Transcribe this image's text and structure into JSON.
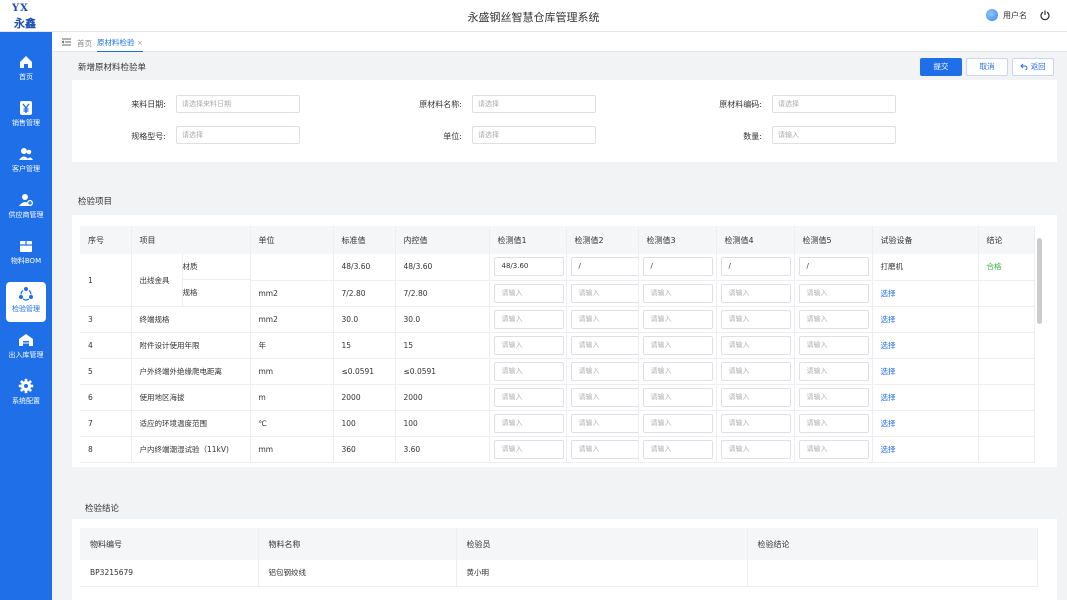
{
  "app": {
    "logo_top": "YX",
    "logo_bottom": "永鑫",
    "title": "永盛钢丝智慧仓库管理系统",
    "username": "用户名"
  },
  "sidebar": {
    "items": [
      {
        "label": "首页",
        "icon": "home-icon"
      },
      {
        "label": "销售管理",
        "icon": "yen-icon"
      },
      {
        "label": "客户管理",
        "icon": "users-icon"
      },
      {
        "label": "供应商管理",
        "icon": "supplier-icon"
      },
      {
        "label": "物料BOM",
        "icon": "box-icon"
      },
      {
        "label": "检验管理",
        "icon": "inspection-icon",
        "active": true
      },
      {
        "label": "出入库管理",
        "icon": "warehouse-icon"
      },
      {
        "label": "系统配置",
        "icon": "gear-icon"
      }
    ]
  },
  "tabs": {
    "breadcrumb": "首页",
    "active_tab": "原材料检验",
    "close": "×"
  },
  "form": {
    "title": "新增原材料检验单",
    "buttons": {
      "submit": "提交",
      "cancel": "取消",
      "back": "返回"
    },
    "fields": [
      {
        "label": "来料日期:",
        "placeholder": "请选择来料日期"
      },
      {
        "label": "原材料名称:",
        "placeholder": "请选择"
      },
      {
        "label": "原材料编码:",
        "placeholder": "请选择"
      },
      {
        "label": "规格型号:",
        "placeholder": "请选择"
      },
      {
        "label": "单位:",
        "placeholder": "请选择"
      },
      {
        "label": "数量:",
        "placeholder": "请输入"
      }
    ]
  },
  "inspection": {
    "title": "检验项目",
    "headers": [
      "序号",
      "项目",
      "单位",
      "标准值",
      "内控值",
      "检测值1",
      "检测值2",
      "检测值3",
      "检测值4",
      "检测值5",
      "试验设备",
      "结论"
    ],
    "input_placeholder": "请输入",
    "rows": [
      {
        "no": "1",
        "item": "出线金具",
        "sub": "材质",
        "unit": "",
        "std": "48/3.60",
        "ctrl": "48/3.60",
        "values": [
          "48/3.60",
          "/",
          "/",
          "/",
          "/"
        ],
        "device": "打磨机",
        "result": "合格"
      },
      {
        "no": "",
        "item": "",
        "sub": "规格",
        "unit": "mm2",
        "std": "7/2.80",
        "ctrl": "7/2.80",
        "values": [],
        "device": "选择",
        "result": ""
      },
      {
        "no": "3",
        "item": "终端规格",
        "unit": "mm2",
        "std": "30.0",
        "ctrl": "30.0",
        "values": [],
        "device": "选择",
        "result": ""
      },
      {
        "no": "4",
        "item": "附件设计使用年限",
        "unit": "年",
        "std": "15",
        "ctrl": "15",
        "values": [],
        "device": "选择",
        "result": ""
      },
      {
        "no": "5",
        "item": "户外终端外绝缘爬电距离",
        "unit": "mm",
        "std": "≤0.0591",
        "ctrl": "≤0.0591",
        "values": [],
        "device": "选择",
        "result": ""
      },
      {
        "no": "6",
        "item": "使用地区海拔",
        "unit": "m",
        "std": "2000",
        "ctrl": "2000",
        "values": [],
        "device": "选择",
        "result": ""
      },
      {
        "no": "7",
        "item": "适应的环境温度范围",
        "unit": "℃",
        "std": "100",
        "ctrl": "100",
        "values": [],
        "device": "选择",
        "result": ""
      },
      {
        "no": "8",
        "item": "户内终端潮湿试验（11kV)",
        "unit": "mm",
        "std": "360",
        "ctrl": "3.60",
        "values": [],
        "device": "选择",
        "result": ""
      }
    ]
  },
  "conclusion": {
    "title": "检验结论",
    "headers": [
      "物料编号",
      "物料名称",
      "检验员",
      "检验结论"
    ],
    "row": [
      "BP3215679",
      "铝包钢绞线",
      "黄小明",
      ""
    ]
  }
}
